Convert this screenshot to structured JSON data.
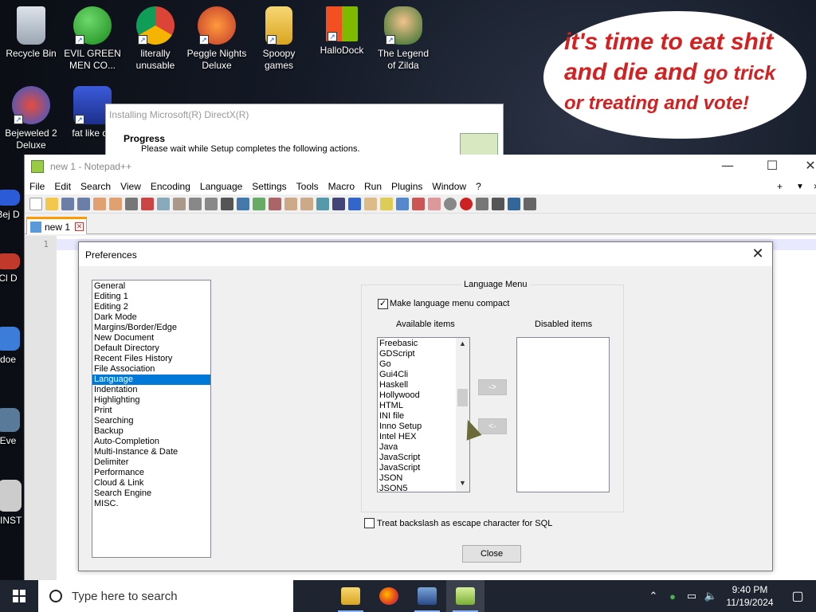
{
  "desktop": {
    "icons": [
      {
        "label": "Recycle Bin"
      },
      {
        "label": "EVIL GREEN MEN CO..."
      },
      {
        "label": "literally unusable"
      },
      {
        "label": "Peggle Nights Deluxe"
      },
      {
        "label": "Spoopy games"
      },
      {
        "label": "HalloDock"
      },
      {
        "label": "The Legend of Zilda"
      },
      {
        "label": "Bejeweled 2 Deluxe"
      },
      {
        "label": "fat like da"
      },
      {
        "label": "Bej D"
      },
      {
        "label": "Cl D"
      },
      {
        "label": "doe"
      },
      {
        "label": "Eve"
      },
      {
        "label": "IINST"
      }
    ],
    "bubble": {
      "line1": "it's time to eat shit",
      "line2a": "and die and ",
      "line2b": "go trick",
      "line3": "or treating and vote!"
    }
  },
  "directx": {
    "title": "Installing Microsoft(R) DirectX(R)",
    "heading": "Progress",
    "subtitle": "Please wait while Setup completes the following actions."
  },
  "notepad": {
    "title": "new 1 - Notepad++",
    "menu": [
      "File",
      "Edit",
      "Search",
      "View",
      "Encoding",
      "Language",
      "Settings",
      "Tools",
      "Macro",
      "Run",
      "Plugins",
      "Window",
      "?"
    ],
    "right_controls": [
      "+",
      "▼",
      "×"
    ],
    "tab": "new 1",
    "line_number": "1"
  },
  "preferences": {
    "title": "Preferences",
    "categories": [
      "General",
      "Editing 1",
      "Editing 2",
      "Dark Mode",
      "Margins/Border/Edge",
      "New Document",
      "Default Directory",
      "Recent Files History",
      "File Association",
      "Language",
      "Indentation",
      "Highlighting",
      "Print",
      "Searching",
      "Backup",
      "Auto-Completion",
      "Multi-Instance & Date",
      "Delimiter",
      "Performance",
      "Cloud & Link",
      "Search Engine",
      "MISC."
    ],
    "selected_category": "Language",
    "group_title": "Language Menu",
    "compact_label": "Make language menu compact",
    "compact_checked": true,
    "available_label": "Available items",
    "disabled_label": "Disabled items",
    "available_items": [
      "Freebasic",
      "GDScript",
      "Go",
      "Gui4Cli",
      "Haskell",
      "Hollywood",
      "HTML",
      "INI file",
      "Inno Setup",
      "Intel HEX",
      "Java",
      "JavaScript",
      "JavaScript",
      "JSON",
      "JSON5"
    ],
    "move_right": "->",
    "move_left": "<-",
    "sql_label": "Treat backslash as escape character for SQL",
    "sql_checked": false,
    "close_label": "Close"
  },
  "taskbar": {
    "search_placeholder": "Type here to search",
    "time": "9:40 PM",
    "date": "11/19/2024"
  }
}
